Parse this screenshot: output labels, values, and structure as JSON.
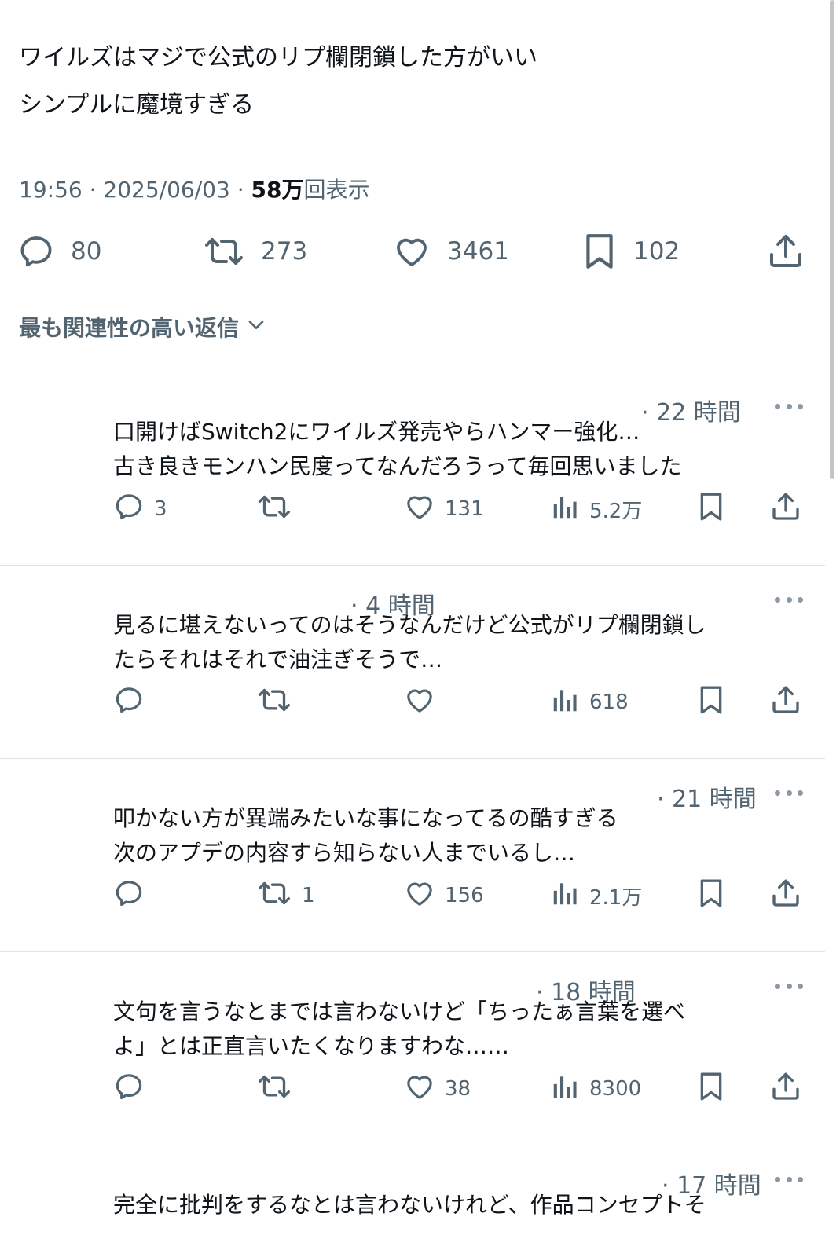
{
  "post": {
    "line1": "ワイルズはマジで公式のリプ欄閉鎖した方がいい",
    "line2": "シンプルに魔境すぎる",
    "time": "19:56",
    "separator1": " · ",
    "date": "2025/06/03",
    "separator2": " · ",
    "views_count": "58万",
    "views_label": "回表示",
    "replies": "80",
    "reposts": "273",
    "likes": "3461",
    "bookmarks": "102"
  },
  "sort": {
    "label": "最も関連性の高い返信"
  },
  "replies": [
    {
      "time": "· 22 時間",
      "line1": "口開けばSwitch2にワイルズ発売やらハンマー強化…",
      "line2": "古き良きモンハン民度ってなんだろうって毎回思いました",
      "replies": "3",
      "reposts": "",
      "likes": "131",
      "views": "5.2万"
    },
    {
      "time": "· 4 時間",
      "line1": "見るに堪えないってのはそうなんだけど公式がリプ欄閉鎖し",
      "line2": "たらそれはそれで油注ぎそうで…",
      "replies": "",
      "reposts": "",
      "likes": "",
      "views": "618"
    },
    {
      "time": "· 21 時間",
      "line1": "叩かない方が異端みたいな事になってるの酷すぎる",
      "line2": "次のアプデの内容すら知らない人までいるし…",
      "replies": "",
      "reposts": "1",
      "likes": "156",
      "views": "2.1万"
    },
    {
      "time": "· 18 時間",
      "line1": "文句を言うなとまでは言わないけど「ちったぁ言葉を選べ",
      "line2": "よ」とは正直言いたくなりますわな……",
      "replies": "",
      "reposts": "",
      "likes": "38",
      "views": "8300"
    },
    {
      "time": "· 17 時間",
      "line1": "完全に批判をするなとは言わないけれど、作品コンセプトそ",
      "line2": ""
    }
  ],
  "icons": {
    "reply": "comment-icon",
    "repost": "repost-icon",
    "like": "heart-icon",
    "views": "views-chart-icon",
    "bookmark": "bookmark-icon",
    "share": "share-icon",
    "more": "more-dots-icon",
    "sort": "chevron-down-icon"
  },
  "colors": {
    "text": "#0f1419",
    "secondary": "#536471",
    "divider": "#dfe3e6"
  }
}
